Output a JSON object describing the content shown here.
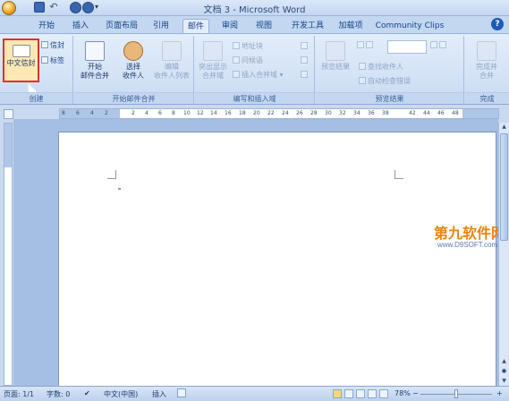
{
  "title_bar": {
    "window_title": "文档 3 - Microsoft Word"
  },
  "tabs": [
    {
      "label": "开始",
      "active": false
    },
    {
      "label": "插入",
      "active": false
    },
    {
      "label": "页面布局",
      "active": false
    },
    {
      "label": "引用",
      "active": false
    },
    {
      "label": "邮件",
      "active": true
    },
    {
      "label": "审阅",
      "active": false
    },
    {
      "label": "视图",
      "active": false
    },
    {
      "label": "开发工具",
      "active": false
    },
    {
      "label": "加载项",
      "active": false
    },
    {
      "label": "Community Clips",
      "active": false
    }
  ],
  "ribbon": {
    "create": {
      "label": "创建",
      "chinese_envelope": "中文信封",
      "envelope": "信封",
      "labels": "标签"
    },
    "start_merge": {
      "label": "开始邮件合并",
      "start_mail_merge": [
        "开始",
        "邮件合并"
      ],
      "select_recipients": [
        "选择",
        "收件人"
      ],
      "edit_recipients": [
        "编辑",
        "收件人列表"
      ]
    },
    "write_insert": {
      "label": "编写和插入域",
      "highlight_fields": [
        "突出显示",
        "合并域"
      ],
      "address_block": "地址块",
      "greeting_line": "问候语",
      "insert_merge_field": "插入合并域"
    },
    "preview": {
      "label": "预览结果",
      "preview_results": "预览结果",
      "find_recipient": "查找收件人",
      "auto_check": "自动检查错误"
    },
    "finish": {
      "label": "完成",
      "finish_merge": [
        "完成并",
        "合并"
      ]
    }
  },
  "ruler_numbers": [
    "8",
    "6",
    "4",
    "2",
    "2",
    "4",
    "6",
    "8",
    "10",
    "12",
    "14",
    "16",
    "18",
    "20",
    "22",
    "24",
    "26",
    "28",
    "30",
    "32",
    "34",
    "36",
    "38",
    "42",
    "44",
    "46",
    "48"
  ],
  "watermark": {
    "text": "第九软件网",
    "url": "www.D9SOFT.com"
  },
  "status_bar": {
    "page": "页面: 1/1",
    "words": "字数: 0",
    "language": "中文(中国)",
    "mode": "插入",
    "zoom": "78%"
  }
}
